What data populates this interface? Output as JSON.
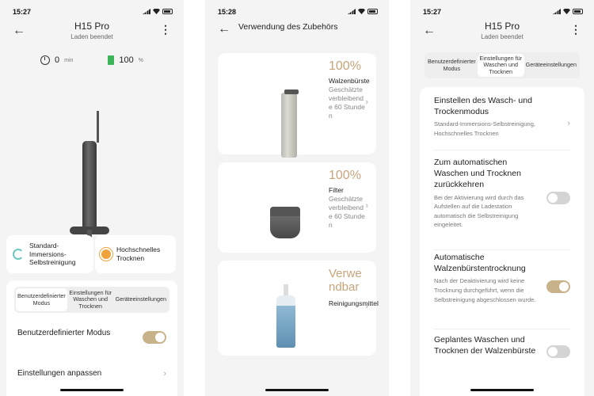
{
  "panel1": {
    "time": "15:27",
    "title": "H15 Pro",
    "subtitle": "Laden beendet",
    "duration_value": "0",
    "duration_unit": "min",
    "battery_value": "100",
    "battery_unit": "%",
    "mode_a": "Standard-Immersions-Selbstreinigung",
    "mode_b": "Hochschnelles Trocknen",
    "tabs": [
      "Benutzerdefinierter Modus",
      "Einstellungen für Waschen und Trocknen",
      "Geräteeinstellungen"
    ],
    "custom_mode_label": "Benutzerdefinierter Modus",
    "custom_mode_on": true,
    "adjust_label": "Einstellungen anpassen"
  },
  "panel2": {
    "time": "15:28",
    "title": "Verwendung des Zubehörs",
    "items": [
      {
        "icon": "roller-brush-icon",
        "value": "100%",
        "name": "Walzenbürste",
        "desc": "Geschätzte verbleibende 60 Stunden"
      },
      {
        "icon": "filter-icon",
        "value": "100%",
        "name": "Filter",
        "desc": "Geschätzte verbleibende 60 Stunden"
      },
      {
        "icon": "cleaner-bottle-icon",
        "value": "Verwendbar",
        "name": "Reinigungsmittel",
        "desc": ""
      }
    ]
  },
  "panel3": {
    "time": "15:27",
    "title": "H15 Pro",
    "subtitle": "Laden beendet",
    "tabs": [
      "Benutzerdefinierter Modus",
      "Einstellungen für Waschen und Trocknen",
      "Geräteeinstellungen"
    ],
    "settings": [
      {
        "title": "Einstellen des Wasch- und Trockenmodus",
        "desc": "Standard-Immersions-Selbstreinigung, Hochschnelles Trocknen"
      },
      {
        "title": "Zum automatischen Waschen und Trocknen zurückkehren",
        "desc": "Bei der Aktivierung wird durch das Aufstellen auf die Ladestation automatisch die Selbstreinigung eingeleitet."
      },
      {
        "title": "Automatische Walzenbürstentrocknung",
        "desc": "Nach der Deaktivierung wird keine Trocknung durchgeführt, wenn die Selbstreinigung abgeschlossen wurde."
      },
      {
        "title": "Geplantes Waschen und Trocknen der Walzenbürste",
        "desc": ""
      }
    ],
    "toggles": {
      "auto_return": false,
      "auto_dry": true,
      "scheduled": false
    }
  },
  "colors": {
    "accent_gold": "#c6a47a",
    "toggle_on": "#c7b28a",
    "toggle_off": "#d4d4d4",
    "battery_green": "#3cb55a"
  }
}
